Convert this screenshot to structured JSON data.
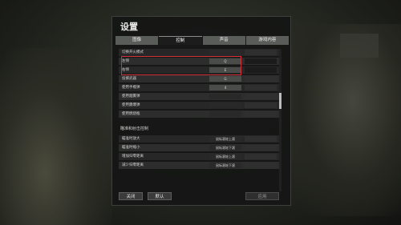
{
  "dialog": {
    "title": "设置",
    "tabs": [
      {
        "label": "图像",
        "active": false
      },
      {
        "label": "控制",
        "active": true
      },
      {
        "label": "声音",
        "active": false
      },
      {
        "label": "游戏内容",
        "active": false
      }
    ]
  },
  "rows_top": [
    {
      "label": "切换开火模式",
      "key1": "",
      "key1_light": false
    },
    {
      "label": "左倾",
      "key1": "Q",
      "key1_light": true
    },
    {
      "label": "右倾",
      "key1": "E",
      "key1_light": true
    },
    {
      "label": "投掷武器",
      "key1": "G",
      "key1_light": true
    },
    {
      "label": "使用手榴弹",
      "key1": "4",
      "key1_light": true
    },
    {
      "label": "使用烟雾弹",
      "key1": "",
      "key1_light": false
    },
    {
      "label": "使用震爆弹",
      "key1": "",
      "key1_light": false
    },
    {
      "label": "使用燃烧瓶",
      "key1": "",
      "key1_light": false
    }
  ],
  "section_title": "瞄准和射击控制",
  "rows_bottom": [
    {
      "label": "瞄准时放大",
      "key1": "鼠标滚轮上滚"
    },
    {
      "label": "瞄准时缩小",
      "key1": "鼠标滚轮下滚"
    },
    {
      "label": "增加归零距离",
      "key1": "鼠标滚轮上滚"
    },
    {
      "label": "减少归零距离",
      "key1": "鼠标滚轮下滚"
    }
  ],
  "buttons": {
    "close": "关闭",
    "default": "默认",
    "apply": "应用"
  }
}
